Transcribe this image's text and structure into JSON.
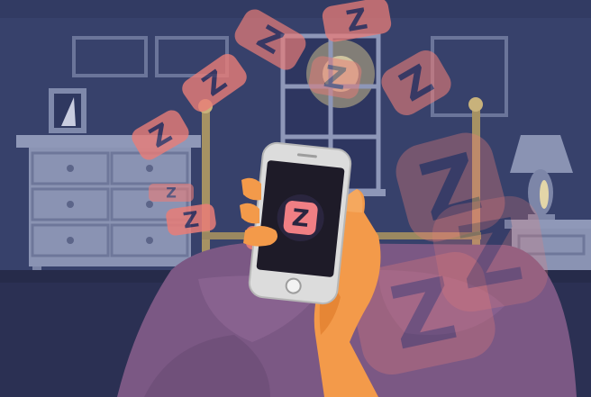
{
  "scene": {
    "description_icon": "sleep-app-illustration",
    "palette": {
      "wall": "#36406a",
      "wall_dark": "#2f3860",
      "floor": "#2a2f52",
      "furniture": "#8a93b3",
      "furniture_shadow": "#6f789a",
      "blanket": "#7a5783",
      "blanket_light": "#9a6d96",
      "window_glow": "#c8b98a",
      "phone_body": "#d9d9d9",
      "phone_screen": "#1e1b28",
      "app_icon": "#f07f84",
      "hand": "#f49a4a",
      "hand_shadow": "#e07f33",
      "z_bubble": "#e97d78"
    }
  },
  "phone": {
    "app_icon_letter": "Z"
  },
  "floating_z": {
    "letter": "Z",
    "count": 12
  }
}
